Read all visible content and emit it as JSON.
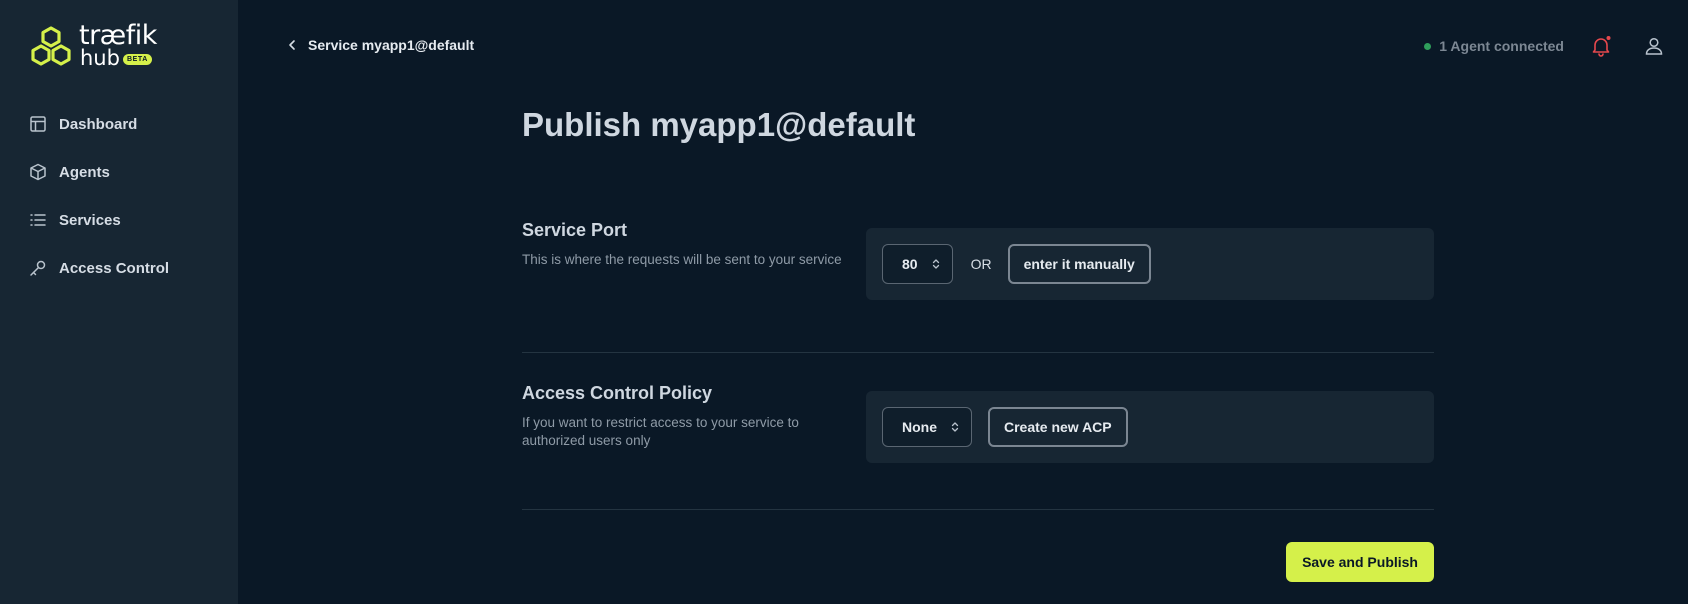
{
  "brand": {
    "name_line1": "træfik",
    "name_line2": "hub",
    "badge": "BETA",
    "accent": "#d5f04a"
  },
  "sidebar": {
    "items": [
      {
        "label": "Dashboard",
        "icon": "layout-icon"
      },
      {
        "label": "Agents",
        "icon": "cube-icon"
      },
      {
        "label": "Services",
        "icon": "list-icon"
      },
      {
        "label": "Access Control",
        "icon": "key-icon"
      }
    ]
  },
  "topbar": {
    "back_label": "Service myapp1@default",
    "agent_status": "1 Agent connected",
    "status_color": "#2f9e5b",
    "notification_color": "#e5484d"
  },
  "main": {
    "title": "Publish myapp1@default",
    "service_port": {
      "heading": "Service Port",
      "description": "This is where the requests will be sent to your service",
      "selected_port": "80",
      "or_label": "OR",
      "manual_button": "enter it manually"
    },
    "access_control": {
      "heading": "Access Control Policy",
      "description": "If you want to restrict access to your service to authorized users only",
      "selected_policy": "None",
      "create_button": "Create new ACP"
    },
    "save_button": "Save and Publish"
  }
}
